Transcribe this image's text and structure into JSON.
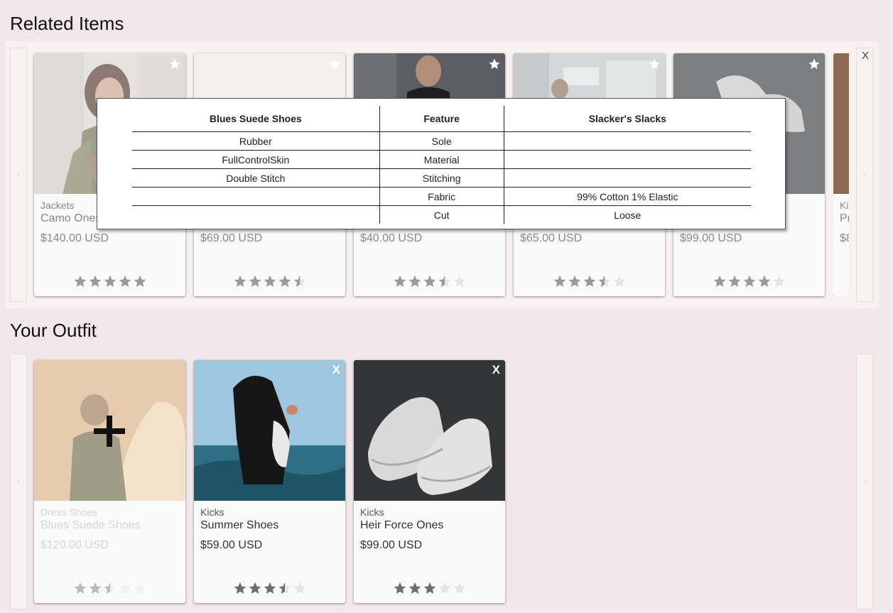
{
  "related": {
    "title": "Related Items",
    "close_label": "X",
    "prev_arrow": "‹",
    "next_arrow": "›",
    "cards": [
      {
        "category": "Jackets",
        "name": "Camo Onesie",
        "price": "$140.00 USD",
        "rating": 5,
        "image": "woman in camo jacket"
      },
      {
        "category": "",
        "name": "",
        "price": "$69.00 USD",
        "rating": 4.5,
        "image": "light product"
      },
      {
        "category": "",
        "name": "",
        "price": "$40.00 USD",
        "rating": 3.5,
        "image": "person in black shirt"
      },
      {
        "category": "",
        "name": "",
        "price": "$65.00 USD",
        "rating": 3.5,
        "image": "person in kitchen"
      },
      {
        "category": "",
        "name": "",
        "price": "$99.00 USD",
        "rating": 4,
        "image": "white sneakers"
      },
      {
        "category": "Ki",
        "name": "Pr",
        "price": "$8",
        "rating": 0,
        "image": "partial"
      }
    ]
  },
  "outfit": {
    "title": "Your Outfit",
    "prev_arrow": "‹",
    "next_arrow": "›",
    "remove_label": "X",
    "cards": [
      {
        "category": "Dress Shoes",
        "name": "Blues Suede Shoes",
        "price": "$120.00 USD",
        "rating": 2.5,
        "add": true
      },
      {
        "category": "Kicks",
        "name": "Summer Shoes",
        "price": "$59.00 USD",
        "rating": 3.5
      },
      {
        "category": "Kicks",
        "name": "Heir Force Ones",
        "price": "$99.00 USD",
        "rating": 3
      }
    ]
  },
  "comparison": {
    "headers": [
      "Blues Suede Shoes",
      "Feature",
      "Slacker's Slacks"
    ],
    "rows": [
      [
        "Rubber",
        "Sole",
        ""
      ],
      [
        "FullControlSkin",
        "Material",
        ""
      ],
      [
        "Double Stitch",
        "Stitching",
        ""
      ],
      [
        "",
        "Fabric",
        "99% Cotton 1% Elastic"
      ],
      [
        "",
        "Cut",
        "Loose"
      ]
    ]
  },
  "colors": {
    "background": "#f2e8eb",
    "star_filled": "#9a9a9a",
    "star_empty": "#e4e4e4",
    "outfit_star_filled": "#6b6e76"
  }
}
